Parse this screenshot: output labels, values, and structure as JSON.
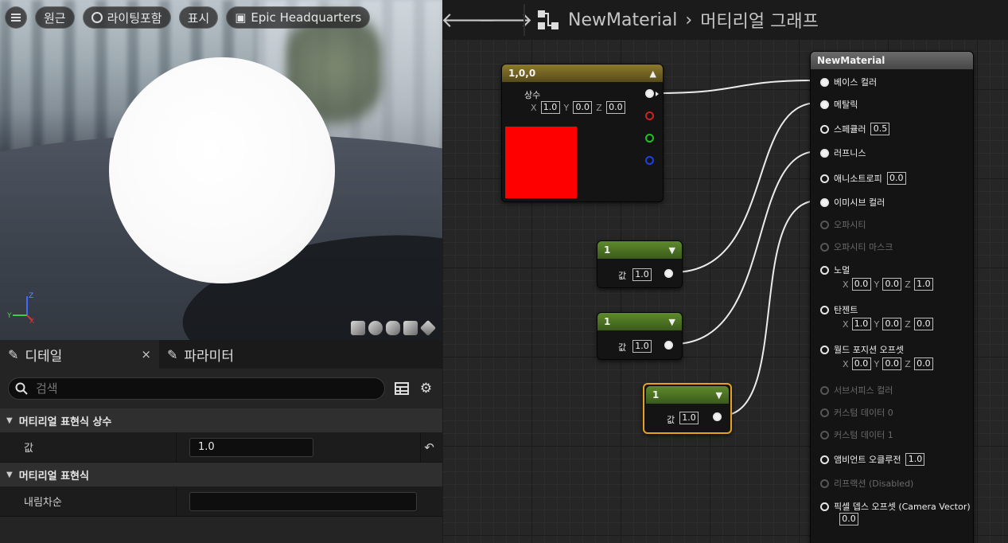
{
  "viewport": {
    "buttons": [
      {
        "name": "menu",
        "label": ""
      },
      {
        "name": "perspective",
        "label": "원근"
      },
      {
        "name": "lighting",
        "label": "라이팅포함"
      },
      {
        "name": "show",
        "label": "표시"
      },
      {
        "name": "scene",
        "label": "Epic Headquarters"
      }
    ],
    "axis": {
      "x": "X",
      "y": "Y",
      "z": "Z"
    }
  },
  "details": {
    "tabs": [
      {
        "label": "디테일"
      },
      {
        "label": "파라미터"
      }
    ],
    "close_label": "×",
    "search_placeholder": "검색",
    "sections": [
      {
        "title": "머티리얼 표현식 상수",
        "rows": [
          {
            "label": "값",
            "value": "1.0"
          }
        ]
      },
      {
        "title": "머티리얼 표현식",
        "rows": [
          {
            "label": "내림차순",
            "value": ""
          }
        ]
      }
    ]
  },
  "graph": {
    "breadcrumb": {
      "asset": "NewMaterial",
      "separator": "›",
      "current": "머티리얼 그래프"
    },
    "const3_node": {
      "title": "1,0,0",
      "output_label": "상수",
      "x": "1.0",
      "y": "0.0",
      "z": "0.0",
      "swatch_color": "#ff0000"
    },
    "scalar_nodes": [
      {
        "title": "1",
        "value_label": "값",
        "value": "1.0"
      },
      {
        "title": "1",
        "value_label": "값",
        "value": "1.0"
      },
      {
        "title": "1",
        "value_label": "값",
        "value": "1.0"
      }
    ],
    "material_node": {
      "title": "NewMaterial",
      "pins": [
        {
          "label": "베이스 컬러",
          "enabled": true,
          "connected": true,
          "value": ""
        },
        {
          "label": "메탈릭",
          "enabled": true,
          "connected": true,
          "value": ""
        },
        {
          "label": "스페큘러",
          "enabled": true,
          "connected": false,
          "value": "0.5"
        },
        {
          "label": "러프니스",
          "enabled": true,
          "connected": true,
          "value": ""
        },
        {
          "label": "애니소트로피",
          "enabled": true,
          "connected": false,
          "value": "0.0"
        },
        {
          "label": "이미시브 컬러",
          "enabled": true,
          "connected": true,
          "value": ""
        },
        {
          "label": "오파시티",
          "enabled": false,
          "connected": false,
          "value": ""
        },
        {
          "label": "오파시티 마스크",
          "enabled": false,
          "connected": false,
          "value": ""
        },
        {
          "label": "노멀",
          "enabled": true,
          "connected": false,
          "xyz": [
            "0.0",
            "0.0",
            "1.0"
          ]
        },
        {
          "label": "탄젠트",
          "enabled": true,
          "connected": false,
          "xyz": [
            "1.0",
            "0.0",
            "0.0"
          ]
        },
        {
          "label": "월드 포지션 오프셋",
          "enabled": true,
          "connected": false,
          "xyz": [
            "0.0",
            "0.0",
            "0.0"
          ]
        },
        {
          "label": "서브서피스 컬러",
          "enabled": false,
          "connected": false,
          "value": ""
        },
        {
          "label": "커스텀 데이터 0",
          "enabled": false,
          "connected": false,
          "value": ""
        },
        {
          "label": "커스텀 데이터 1",
          "enabled": false,
          "connected": false,
          "value": ""
        },
        {
          "label": "앰비언트 오클루전",
          "enabled": true,
          "connected": false,
          "value": "1.0"
        },
        {
          "label": "리프랙션 (Disabled)",
          "enabled": false,
          "connected": false,
          "value": ""
        },
        {
          "label": "픽셀 뎁스 오프셋 (Camera Vector)",
          "enabled": true,
          "connected": false,
          "value": "0.0"
        }
      ]
    },
    "colors": {
      "accent_select": "#e8a020",
      "red_pin": "#d02020",
      "green_pin": "#20c020",
      "blue_pin": "#2040e0"
    }
  }
}
